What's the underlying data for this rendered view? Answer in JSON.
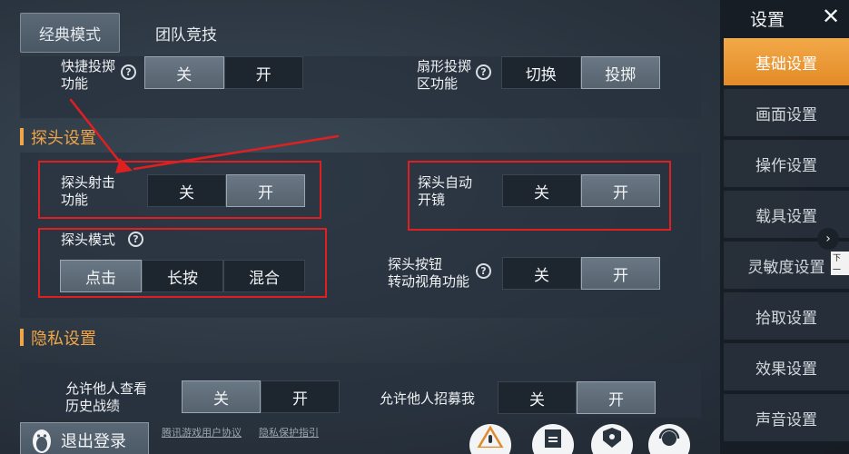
{
  "tabs": {
    "classic": "经典模式",
    "team": "团队竞技"
  },
  "sections": {
    "peek": "探头设置",
    "privacy": "隐私设置"
  },
  "options": {
    "quick_throw": {
      "label_line1": "快捷投掷",
      "label_line2": "功能",
      "off": "关",
      "on": "开"
    },
    "fan_throw": {
      "label_line1": "扇形投掷",
      "label_line2": "区功能",
      "switch": "切换",
      "throw": "投掷"
    },
    "peek_fire": {
      "label_line1": "探头射击",
      "label_line2": "功能",
      "off": "关",
      "on": "开"
    },
    "peek_auto_scope": {
      "label_line1": "探头自动",
      "label_line2": "开镜",
      "off": "关",
      "on": "开"
    },
    "peek_mode": {
      "label": "探头模式",
      "tap": "点击",
      "hold": "长按",
      "mixed": "混合"
    },
    "peek_button_rotate": {
      "label_line1": "探头按钮",
      "label_line2": "转动视角功能",
      "off": "关",
      "on": "开"
    },
    "allow_view_history": {
      "label_line1": "允许他人查看",
      "label_line2": "历史战绩",
      "off": "关",
      "on": "开"
    },
    "allow_recruit": {
      "label": "允许他人招募我",
      "off": "关",
      "on": "开"
    }
  },
  "help_glyph": "?",
  "sidebar": {
    "title": "设置",
    "close": "✕",
    "items": [
      "基础设置",
      "画面设置",
      "操作设置",
      "载具设置",
      "灵敏度设置",
      "拾取设置",
      "效果设置",
      "声音设置"
    ],
    "active_index": 0,
    "next_hint": "下一"
  },
  "bottom": {
    "logout": "退出登录",
    "user_agreement": "腾讯游戏用户协议",
    "privacy_guide": "隐私保护指引"
  },
  "colors": {
    "accent": "#f0a648",
    "annotation_red": "#e02020"
  }
}
